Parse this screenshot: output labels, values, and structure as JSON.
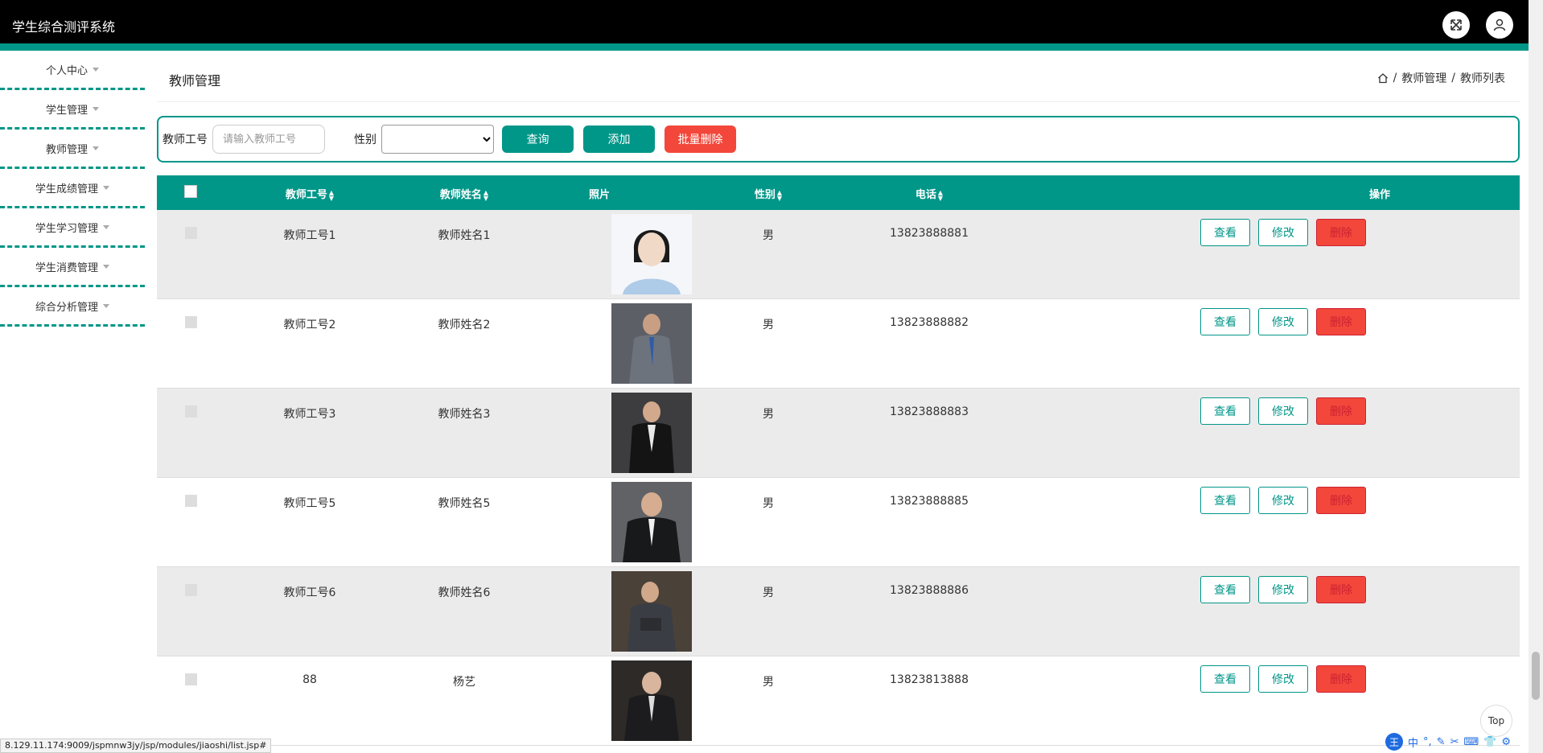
{
  "app": {
    "title": "学生综合测评系统"
  },
  "sidebar": {
    "items": [
      {
        "label": "个人中心"
      },
      {
        "label": "学生管理"
      },
      {
        "label": "教师管理"
      },
      {
        "label": "学生成绩管理"
      },
      {
        "label": "学生学习管理"
      },
      {
        "label": "学生消费管理"
      },
      {
        "label": "综合分析管理"
      }
    ]
  },
  "page": {
    "title": "教师管理",
    "breadcrumb": {
      "sep": "/",
      "level1": "教师管理",
      "level2": "教师列表"
    }
  },
  "filter": {
    "id_label": "教师工号",
    "id_placeholder": "请输入教师工号",
    "sex_label": "性别",
    "query_label": "查询",
    "add_label": "添加",
    "batch_delete_label": "批量删除"
  },
  "table": {
    "headers": {
      "id": "教师工号",
      "name": "教师姓名",
      "photo": "照片",
      "sex": "性别",
      "phone": "电话",
      "ops": "操作"
    },
    "ops": {
      "view": "查看",
      "edit": "修改",
      "delete": "删除"
    },
    "rows": [
      {
        "id": "教师工号1",
        "name": "教师姓名1",
        "sex": "男",
        "phone": "13823888881"
      },
      {
        "id": "教师工号2",
        "name": "教师姓名2",
        "sex": "男",
        "phone": "13823888882"
      },
      {
        "id": "教师工号3",
        "name": "教师姓名3",
        "sex": "男",
        "phone": "13823888883"
      },
      {
        "id": "教师工号5",
        "name": "教师姓名5",
        "sex": "男",
        "phone": "13823888885"
      },
      {
        "id": "教师工号6",
        "name": "教师姓名6",
        "sex": "男",
        "phone": "13823888886"
      },
      {
        "id": "88",
        "name": "杨艺",
        "sex": "男",
        "phone": "13823813888"
      }
    ]
  },
  "footer": {
    "top_label": "Top",
    "status_url": "8.129.11.174:9009/jspmnw3jy/jsp/modules/jiaoshi/list.jsp#",
    "ime_label": "中"
  },
  "colors": {
    "accent": "#009688",
    "danger": "#f2473a",
    "topbar": "#000000"
  }
}
